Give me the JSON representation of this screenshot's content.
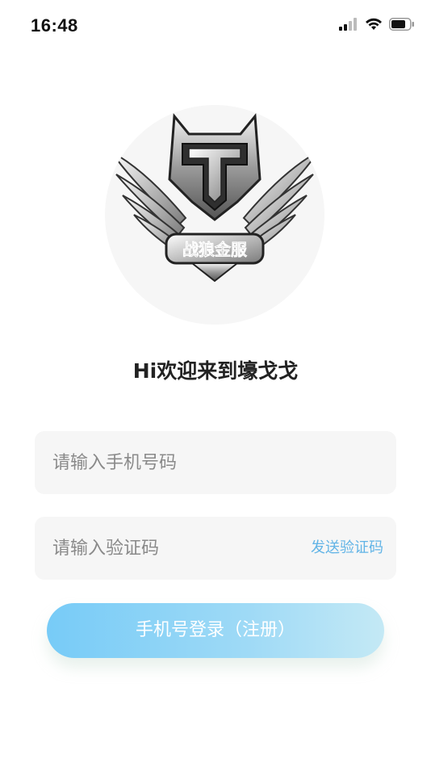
{
  "status_bar": {
    "time": "16:48",
    "icons": [
      "cellular-signal-icon",
      "wifi-icon",
      "battery-icon"
    ]
  },
  "logo": {
    "icon": "wolf-wings-emblem-icon",
    "emblem_text": "战狼金服"
  },
  "greeting": "Hi欢迎来到壕戈戈",
  "form": {
    "phone_placeholder": "请输入手机号码",
    "code_placeholder": "请输入验证码",
    "send_code_label": "发送验证码",
    "submit_label": "手机号登录（注册）"
  },
  "colors": {
    "accent": "#62b4e6",
    "button_gradient_start": "#77cbf7",
    "button_gradient_end": "#c4e9f5",
    "field_bg": "#f6f6f6"
  }
}
